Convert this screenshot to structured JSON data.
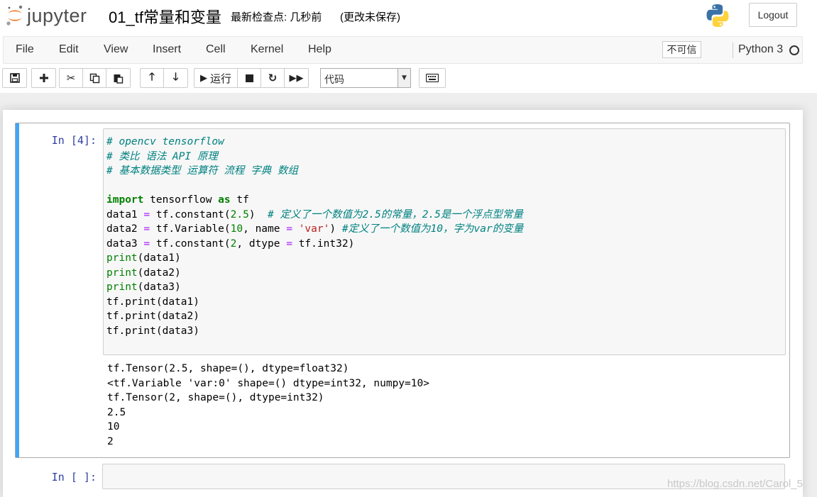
{
  "header": {
    "logo_text": "jupyter",
    "notebook_title": "01_tf常量和变量",
    "checkpoint": "最新检查点: 几秒前",
    "unsaved": "(更改未保存)",
    "logout_label": "Logout"
  },
  "menubar": {
    "items": [
      "File",
      "Edit",
      "View",
      "Insert",
      "Cell",
      "Kernel",
      "Help"
    ],
    "trust_label": "不可信",
    "kernel_name": "Python 3"
  },
  "toolbar": {
    "run_label": "运行",
    "cell_type": "代码"
  },
  "cells": [
    {
      "prompt": "In  [4]:",
      "code": [
        "# opencv tensorflow",
        "# 类比 语法 API 原理",
        "# 基本数据类型 运算符 流程 字典 数组",
        "",
        "import tensorflow as tf",
        "data1 = tf.constant(2.5)  # 定义了一个数值为2.5的常量，2.5是一个浮点型常量",
        "data2 = tf.Variable(10, name = 'var') #定义了一个数值为10，字为var的变量",
        "data3 = tf.constant(2, dtype = tf.int32)",
        "print(data1)",
        "print(data2)",
        "print(data3)",
        "tf.print(data1)",
        "tf.print(data2)",
        "tf.print(data3)"
      ],
      "output": [
        "tf.Tensor(2.5, shape=(), dtype=float32)",
        "<tf.Variable 'var:0' shape=() dtype=int32, numpy=10>",
        "tf.Tensor(2, shape=(), dtype=int32)",
        "2.5",
        "10",
        "2"
      ]
    },
    {
      "prompt": "In  [ ]:"
    }
  ],
  "watermark": "https://blog.csdn.net/Carol_5",
  "colors": {
    "selected_cell_bar": "#42a5f5",
    "prompt": "#303f9f",
    "keyword": "#008000",
    "comment": "#008080",
    "string": "#ba2121",
    "operator": "#aa22ff"
  }
}
